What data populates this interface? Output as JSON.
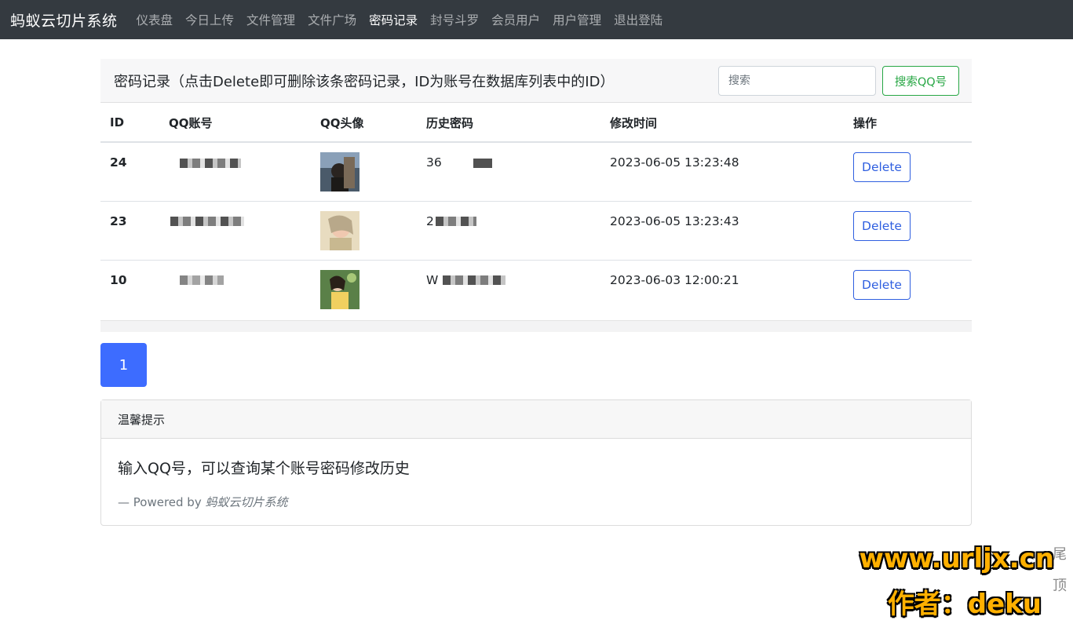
{
  "nav": {
    "brand": "蚂蚁云切片系统",
    "items": [
      "仪表盘",
      "今日上传",
      "文件管理",
      "文件广场",
      "密码记录",
      "封号斗罗",
      "会员用户",
      "用户管理",
      "退出登陆"
    ],
    "active_index": 4
  },
  "panel": {
    "title": "密码记录（点击Delete即可删除该条密码记录，ID为账号在数据库列表中的ID）",
    "search_placeholder": "搜索",
    "search_button": "搜索QQ号"
  },
  "table": {
    "headers": [
      "ID",
      "QQ账号",
      "QQ头像",
      "历史密码",
      "修改时间",
      "操作"
    ],
    "rows": [
      {
        "id": "24",
        "password_prefix": "36",
        "time": "2023-06-05 13:23:48",
        "action": "Delete"
      },
      {
        "id": "23",
        "password_prefix": "2",
        "time": "2023-06-05 13:23:43",
        "action": "Delete"
      },
      {
        "id": "10",
        "password_prefix": "W",
        "time": "2023-06-03 12:00:21",
        "action": "Delete"
      }
    ]
  },
  "pagination": {
    "current": "1"
  },
  "tip": {
    "header": "温馨提示",
    "body": "输入QQ号，可以查询某个账号密码修改历史",
    "footer_prefix": "— Powered by ",
    "footer_name": "蚂蚁云切片系统"
  },
  "side": {
    "tab1": "尾",
    "tab2": "顶"
  },
  "watermark": {
    "line1": "www.urljx.cn",
    "line2": "作者：deku"
  },
  "colors": {
    "navbar": "#343a40",
    "primary": "#3d6cff",
    "success": "#28a745"
  }
}
